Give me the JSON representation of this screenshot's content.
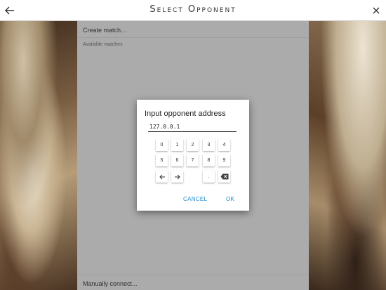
{
  "header": {
    "title": "Select Opponent",
    "back_icon": "arrow-left-icon",
    "close_icon": "close-icon"
  },
  "panel": {
    "create_match": "Create match...",
    "available_matches": "Available matches",
    "manual_connect": "Manually connect..."
  },
  "dialog": {
    "title": "Input opponent address",
    "address_value": "127.0.0.1",
    "keys_row1": [
      "0",
      "1",
      "2",
      "3",
      "4"
    ],
    "keys_row2": [
      "5",
      "6",
      "7",
      "8",
      "9"
    ],
    "key_left_icon": "arrow-left-icon",
    "key_right_icon": "arrow-right-icon",
    "key_dot": ".",
    "key_backspace_icon": "backspace-icon",
    "cancel_label": "CANCEL",
    "ok_label": "OK"
  },
  "colors": {
    "accent": "#1e88c9",
    "panel_bg": "#ababab"
  }
}
